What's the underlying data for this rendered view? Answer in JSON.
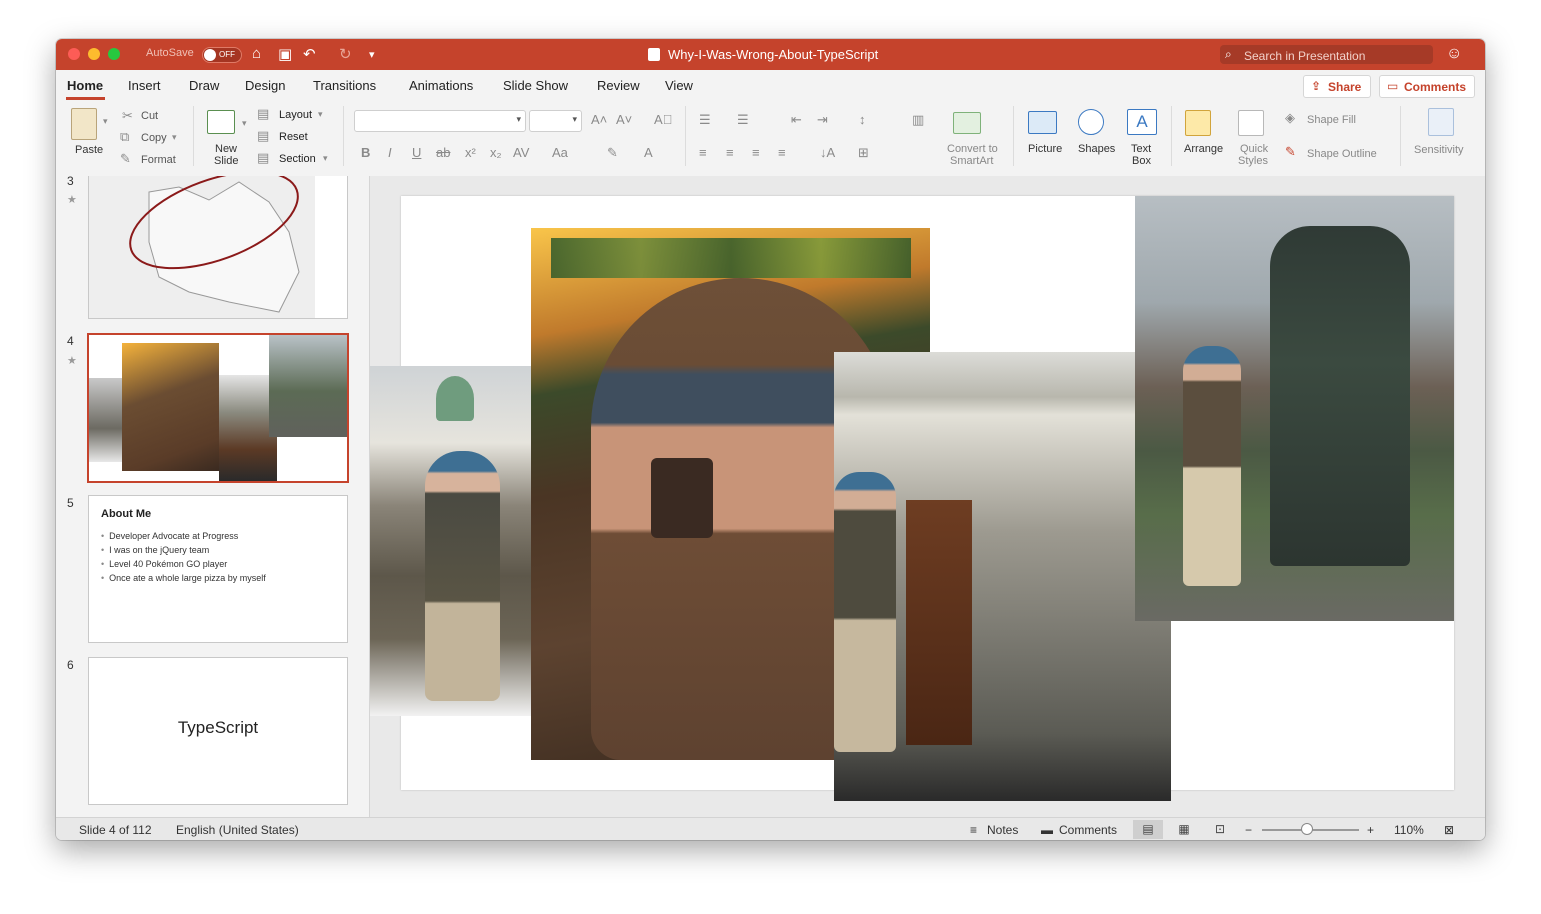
{
  "window": {
    "title": "Why-I-Was-Wrong-About-TypeScript",
    "autosave_label": "AutoSave",
    "autosave_state": "OFF",
    "search_placeholder": "Search in Presentation"
  },
  "tabs": [
    {
      "label": "Home",
      "active": true
    },
    {
      "label": "Insert"
    },
    {
      "label": "Draw"
    },
    {
      "label": "Design"
    },
    {
      "label": "Transitions"
    },
    {
      "label": "Animations"
    },
    {
      "label": "Slide Show"
    },
    {
      "label": "Review"
    },
    {
      "label": "View"
    }
  ],
  "actions": {
    "share": "Share",
    "comments": "Comments"
  },
  "ribbon": {
    "paste": "Paste",
    "cut": "Cut",
    "copy": "Copy",
    "format": "Format",
    "new_slide_1": "New",
    "new_slide_2": "Slide",
    "layout": "Layout",
    "reset": "Reset",
    "section": "Section",
    "convert_1": "Convert to",
    "convert_2": "SmartArt",
    "picture": "Picture",
    "shapes": "Shapes",
    "textbox_1": "Text",
    "textbox_2": "Box",
    "arrange": "Arrange",
    "quick_styles_1": "Quick",
    "quick_styles_2": "Styles",
    "shape_fill": "Shape Fill",
    "shape_outline": "Shape Outline",
    "sensitivity": "Sensitivity"
  },
  "thumbnails": [
    {
      "number": "3"
    },
    {
      "number": "4",
      "selected": true
    },
    {
      "number": "5",
      "title": "About Me",
      "bullets": [
        "Developer Advocate at Progress",
        "I was on the jQuery team",
        "Level 40 Pokémon GO player",
        "Once ate a whole large pizza by myself"
      ]
    },
    {
      "number": "6",
      "title": "TypeScript"
    }
  ],
  "status": {
    "slide_position": "Slide 4 of 112",
    "language": "English (United States)",
    "notes": "Notes",
    "comments": "Comments",
    "zoom": "110%",
    "zoom_fraction": 0.45
  },
  "colors": {
    "accent": "#c5432c",
    "titlebar": "#c5432c"
  },
  "icons": [
    "home-icon",
    "save-icon",
    "undo-icon",
    "redo-icon",
    "customize-icon",
    "search-icon",
    "smiley-icon",
    "share-icon",
    "comment-icon"
  ]
}
